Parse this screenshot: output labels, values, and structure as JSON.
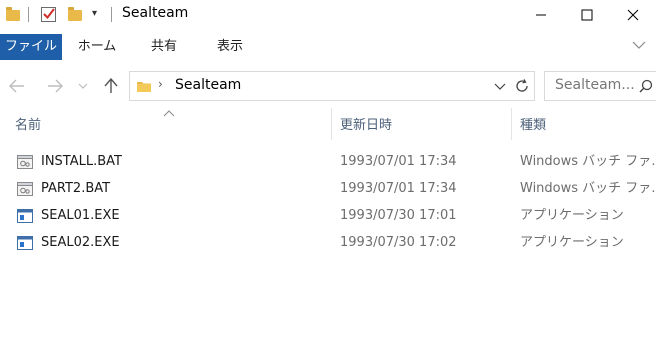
{
  "window": {
    "title": "Sealteam"
  },
  "ribbon": {
    "tabs": [
      "ファイル",
      "ホーム",
      "共有",
      "表示"
    ]
  },
  "address": {
    "path_segment": "Sealteam"
  },
  "search": {
    "placeholder": "Sealteam..."
  },
  "columns": {
    "name": "名前",
    "date": "更新日時",
    "type": "種類"
  },
  "files": [
    {
      "name": "INSTALL.BAT",
      "date": "1993/07/01 17:34",
      "type": "Windows バッチ ファ…",
      "icon": "batch-file-icon"
    },
    {
      "name": "PART2.BAT",
      "date": "1993/07/01 17:34",
      "type": "Windows バッチ ファ…",
      "icon": "batch-file-icon"
    },
    {
      "name": "SEAL01.EXE",
      "date": "1993/07/30 17:01",
      "type": "アプリケーション",
      "icon": "application-icon"
    },
    {
      "name": "SEAL02.EXE",
      "date": "1993/07/30 17:02",
      "type": "アプリケーション",
      "icon": "application-icon"
    }
  ],
  "colors": {
    "accent": "#1f5ea8",
    "folder": "#e9b949",
    "header_text": "#4c607a",
    "secondary_text": "#6d6d6d"
  }
}
